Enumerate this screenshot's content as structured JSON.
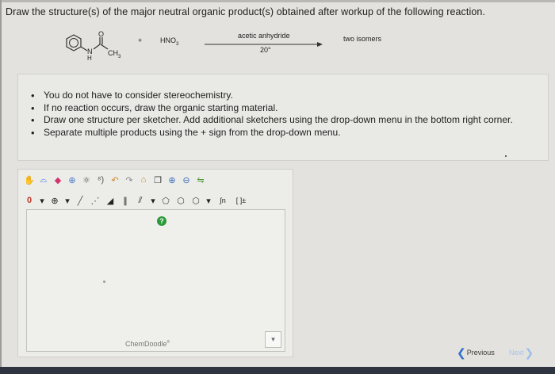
{
  "question": {
    "text": "Draw the structure(s) of the major neutral organic product(s) obtained after workup of the following reaction."
  },
  "reaction": {
    "substituent_O": "O",
    "substituent_N": "N",
    "substituent_H": "H",
    "substituent_CH": "CH",
    "substituent_CH_sub": "3",
    "plus": "+",
    "reagent": "HNO",
    "reagent_sub": "3",
    "condition_top": "acetic anhydride",
    "condition_bottom": "20°",
    "product_note": "two isomers"
  },
  "instructions": {
    "items": [
      "You do not have to consider stereochemistry.",
      "If no reaction occurs, draw the organic starting material.",
      "Draw one structure per sketcher. Add additional sketchers using the drop-down menu in the bottom right corner.",
      "Separate multiple products using the + sign from the drop-down menu."
    ]
  },
  "sketcher": {
    "help_label": "?",
    "brand": "ChemDoodle",
    "brand_mark": "®",
    "toolbar2": {
      "zero_label": "0",
      "plus_label": "⊕",
      "caret": "▾",
      "bracket_label": "[ ]±",
      "sn_label": "∫n"
    }
  },
  "navigation": {
    "previous_label": "Previous",
    "next_label": "Next",
    "prev_chevron": "❮",
    "next_chevron": "❯"
  },
  "colors": {
    "help_green": "#2c9a3a",
    "nav_blue": "#2f6fd0"
  }
}
